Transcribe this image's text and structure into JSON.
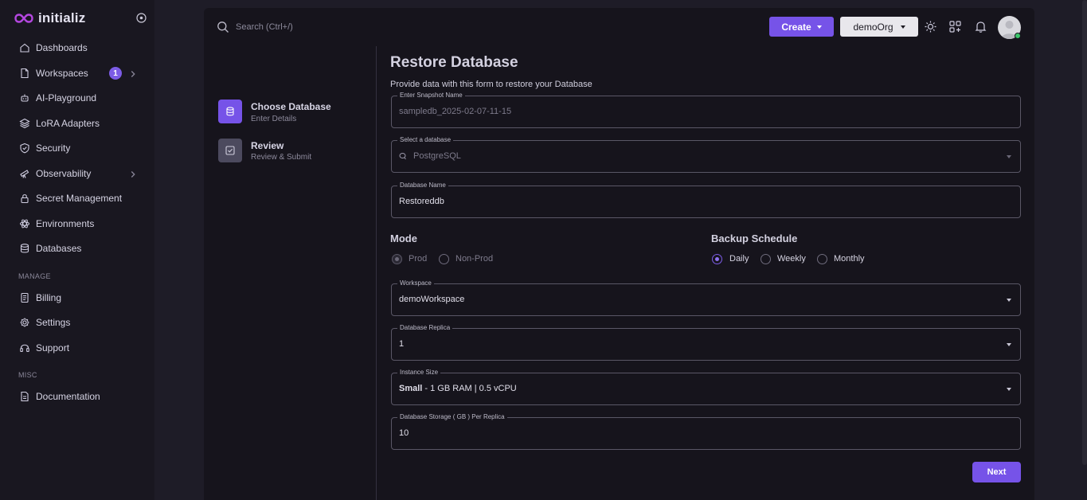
{
  "brand": {
    "name": "initializ",
    "accent": "#b447e0"
  },
  "sidebar": {
    "items": [
      {
        "label": "Dashboards",
        "icon": "home-icon"
      },
      {
        "label": "Workspaces",
        "icon": "file-icon",
        "badge": "1"
      },
      {
        "label": "AI-Playground",
        "icon": "robot-icon"
      },
      {
        "label": "LoRA Adapters",
        "icon": "layers-icon"
      },
      {
        "label": "Security",
        "icon": "shield-icon"
      },
      {
        "label": "Observability",
        "icon": "telescope-icon"
      },
      {
        "label": "Secret Management",
        "icon": "lock-icon"
      },
      {
        "label": "Environments",
        "icon": "atom-icon"
      },
      {
        "label": "Databases",
        "icon": "database-icon"
      }
    ],
    "manage_label": "MANAGE",
    "manage_items": [
      {
        "label": "Billing",
        "icon": "receipt-icon"
      },
      {
        "label": "Settings",
        "icon": "gear-icon"
      },
      {
        "label": "Support",
        "icon": "headset-icon"
      }
    ],
    "misc_label": "MISC",
    "misc_items": [
      {
        "label": "Documentation",
        "icon": "document-icon"
      }
    ]
  },
  "topbar": {
    "search_placeholder": "Search (Ctrl+/)",
    "create_label": "Create",
    "org_label": "demoOrg"
  },
  "stepper": [
    {
      "title": "Choose Database",
      "subtitle": "Enter Details",
      "active": true
    },
    {
      "title": "Review",
      "subtitle": "Review & Submit",
      "active": false
    }
  ],
  "form": {
    "title": "Restore Database",
    "subtitle": "Provide data with this form to restore your Database",
    "snapshot": {
      "label": "Enter Snapshot Name",
      "value": "sampledb_2025-02-07-11-15"
    },
    "database_type": {
      "label": "Select a database",
      "value": "PostgreSQL"
    },
    "database_name": {
      "label": "Database Name",
      "value": "Restoreddb"
    },
    "mode": {
      "heading": "Mode",
      "options": [
        "Prod",
        "Non-Prod"
      ],
      "selected": "Prod"
    },
    "backup": {
      "heading": "Backup Schedule",
      "options": [
        "Daily",
        "Weekly",
        "Monthly"
      ],
      "selected": "Daily"
    },
    "workspace": {
      "label": "Workspace",
      "value": "demoWorkspace"
    },
    "replica": {
      "label": "Database Replica",
      "value": "1"
    },
    "instance_size": {
      "label": "Instance Size",
      "value_bold": "Small",
      "value_rest": " - 1 GB RAM | 0.5 vCPU"
    },
    "storage": {
      "label": "Database Storage ( GB ) Per Replica",
      "value": "10"
    },
    "next_label": "Next"
  }
}
